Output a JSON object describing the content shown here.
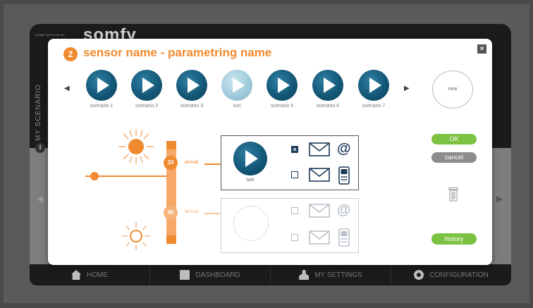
{
  "app": {
    "brand_small": "HOME MOTION BY",
    "brand": "somfy",
    "side_label": "MY SCENARIO",
    "info_glyph": "i"
  },
  "bottom_nav": [
    {
      "label": "HOME",
      "icon": "home-icon"
    },
    {
      "label": "DASHBOARD",
      "icon": "dashboard-icon"
    },
    {
      "label": "MY SETTINGS",
      "icon": "person-icon"
    },
    {
      "label": "CONFIGURATION",
      "icon": "gear-icon"
    }
  ],
  "modal": {
    "step": "2",
    "title": "sensor name - parametring name",
    "close_glyph": "×"
  },
  "scenarios": [
    {
      "label": "scenario 1",
      "state": "active"
    },
    {
      "label": "scenario 2",
      "state": "active"
    },
    {
      "label": "scenario 3",
      "state": "active"
    },
    {
      "label": "sun",
      "state": "selected-light"
    },
    {
      "label": "scenario 5",
      "state": "active"
    },
    {
      "label": "scenario 6",
      "state": "active"
    },
    {
      "label": "scenario 7",
      "state": "active"
    }
  ],
  "carousel": {
    "prev": "◀",
    "next": "▶"
  },
  "new_button": "new",
  "actions": {
    "ok": "OK",
    "cancel": "cancel",
    "history": "history"
  },
  "thresholds": [
    {
      "value": "30",
      "label": "arrival"
    },
    {
      "value": "45",
      "label": "arrival"
    }
  ],
  "rule_boxes": [
    {
      "scenario": "sun",
      "checks": [
        true,
        false
      ]
    },
    {
      "scenario": "",
      "checks": [
        false,
        false
      ]
    }
  ],
  "colors": {
    "accent": "#f08a30",
    "scenario_blue": "#145878",
    "ok_green": "#7cc242"
  }
}
